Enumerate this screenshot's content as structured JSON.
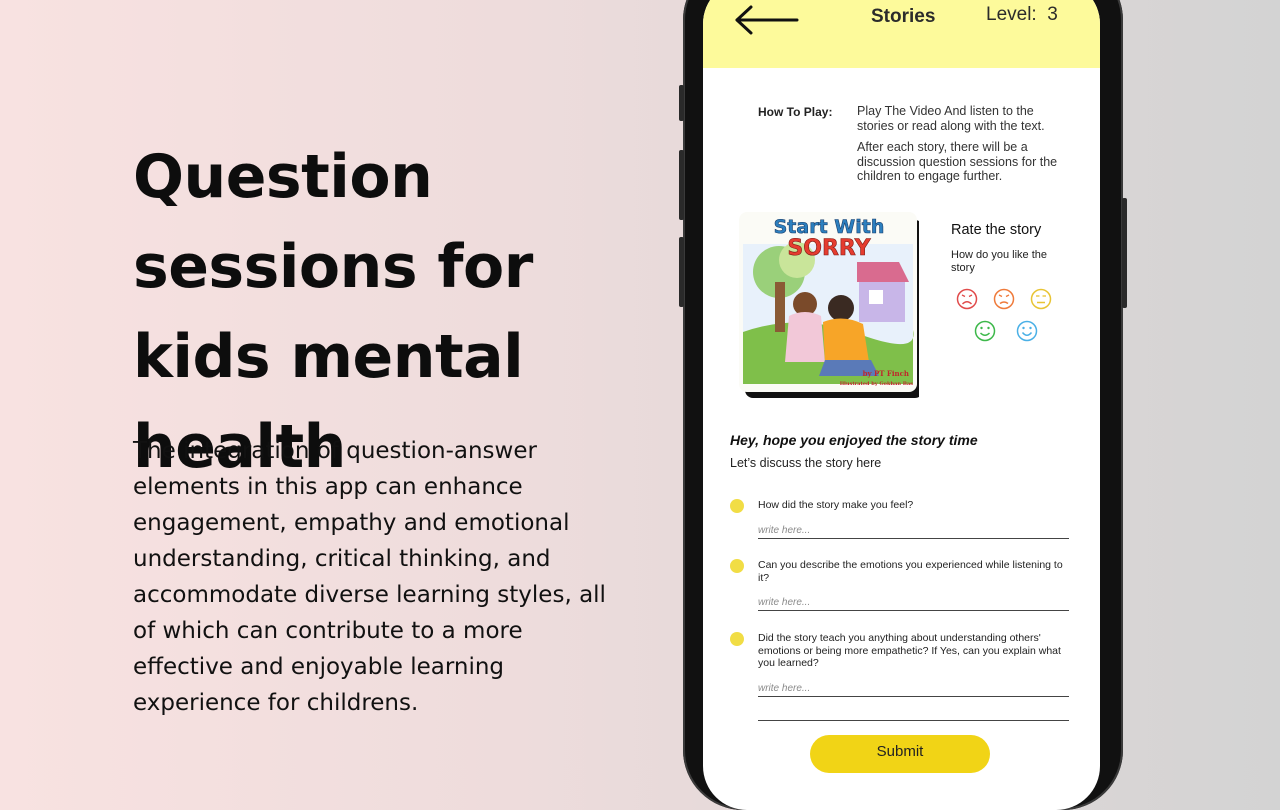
{
  "hero": {
    "title": "Question sessions for kids mental health",
    "description": "The integration of question-answer elements in this app can enhance engagement, empathy and emotional understanding, critical thinking, and accommodate diverse learning styles, all of which can contribute to a more effective and enjoyable learning experience for childrens."
  },
  "app": {
    "header": {
      "back_icon": "arrow-left-icon",
      "title": "Stories",
      "level": "Level:  3",
      "background": "#fdfa9b"
    },
    "how_to_play": {
      "label": "How To Play:",
      "line1": "Play The Video And listen to the stories or read along with the text.",
      "line2": "After each story, there will be a discussion question sessions for the children to engage further."
    },
    "book": {
      "title_line1": "Start With",
      "title_line2": "SORRY",
      "author": "by PT Finch",
      "illustrator": "Illustrated by Gokhan Bas"
    },
    "rating": {
      "title": "Rate the story",
      "subtitle": "How do you like the story",
      "faces": [
        {
          "name": "very-sad-face-icon",
          "color": "#e14b4b"
        },
        {
          "name": "sad-face-icon",
          "color": "#ef7a3a"
        },
        {
          "name": "neutral-face-icon",
          "color": "#e8c434"
        },
        {
          "name": "happy-face-icon",
          "color": "#3db84a"
        },
        {
          "name": "very-happy-face-icon",
          "color": "#4ab0e6"
        }
      ]
    },
    "discussion": {
      "title": "Hey, hope you enjoyed the story time",
      "subtitle": "Let’s discuss the story here",
      "questions": [
        {
          "text": "How did the story make you feel?",
          "placeholder": "write here..."
        },
        {
          "text": "Can you describe the emotions you experienced while listening to it?",
          "placeholder": "write here..."
        },
        {
          "text": "Did the story teach you anything about understanding others' emotions or being more empathetic? If Yes, can you explain what you learned?",
          "placeholder": "write here..."
        }
      ],
      "submit_label": "Submit",
      "accent": "#f1d416"
    }
  }
}
